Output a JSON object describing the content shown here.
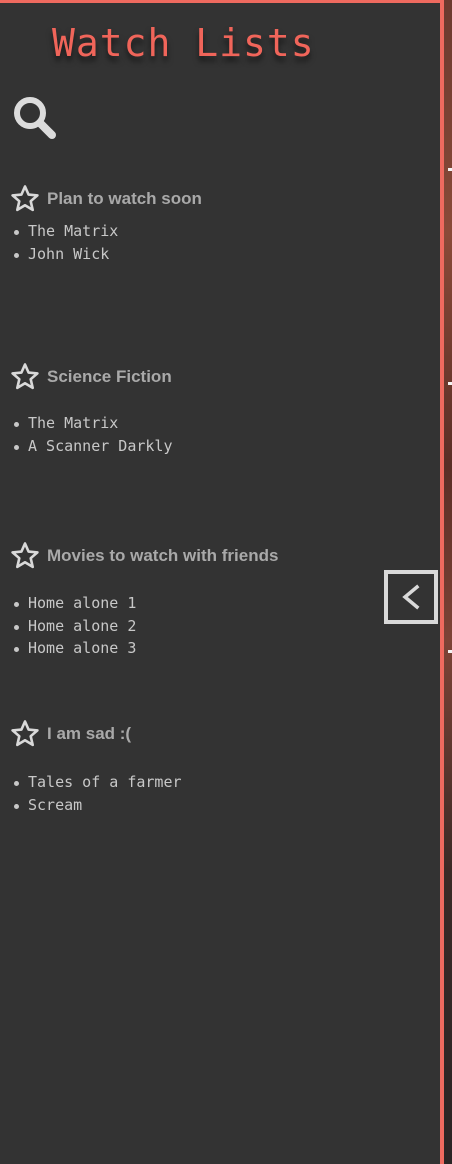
{
  "app": {
    "title": "Watch Lists"
  },
  "colors": {
    "accent": "#ef6a5f",
    "panel_bg": "#333333",
    "list_title": "#a9a9a9",
    "item_text": "#c8c8c8",
    "icon": "#d9d9d9"
  },
  "toolbar": {
    "search_icon": "search-icon"
  },
  "lists": [
    {
      "title": "Plan to watch soon",
      "icon": "star-outline-icon",
      "items": [
        "The Matrix",
        "John Wick"
      ]
    },
    {
      "title": "Science Fiction",
      "icon": "star-outline-icon",
      "items": [
        "The Matrix",
        "A Scanner Darkly"
      ]
    },
    {
      "title": "Movies to watch with friends",
      "icon": "star-outline-icon",
      "items": [
        "Home alone 1",
        "Home alone 2",
        "Home alone 3"
      ]
    },
    {
      "title": "I am sad :(",
      "icon": "star-outline-icon",
      "items": [
        "Tales of a farmer",
        "Scream"
      ]
    }
  ],
  "panel_toggle": {
    "icon": "chevron-left-icon"
  }
}
